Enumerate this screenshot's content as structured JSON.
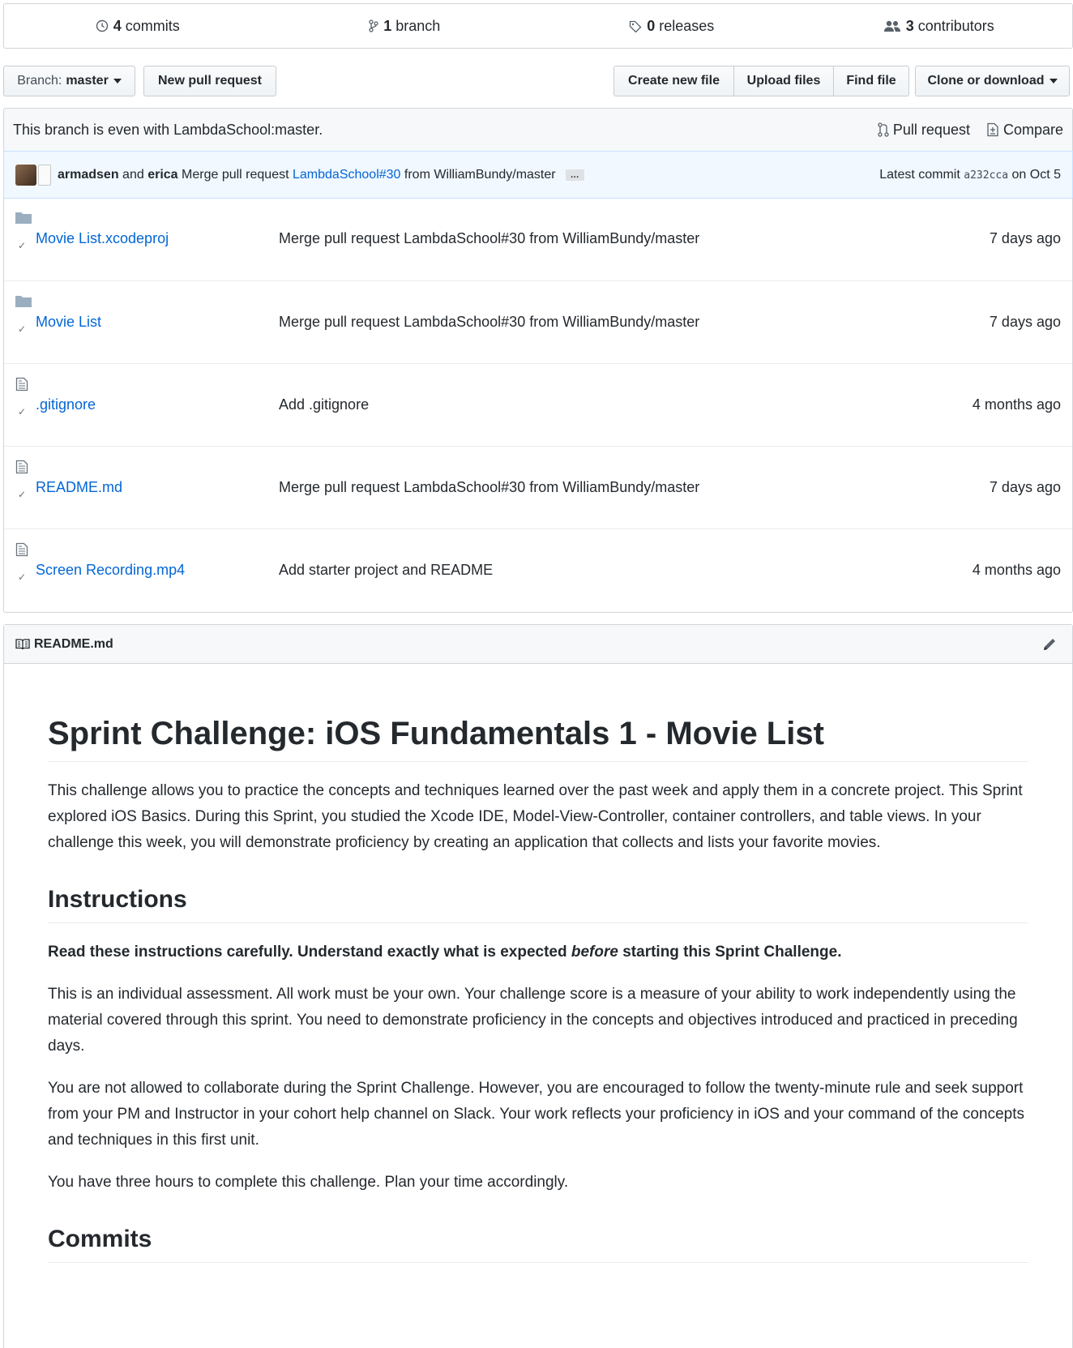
{
  "summary": {
    "commits": {
      "count": "4",
      "label": "commits"
    },
    "branches": {
      "count": "1",
      "label": "branch"
    },
    "releases": {
      "count": "0",
      "label": "releases"
    },
    "contributors": {
      "count": "3",
      "label": "contributors"
    }
  },
  "toolbar": {
    "branch_prefix": "Branch:",
    "branch_name": "master",
    "new_pr": "New pull request",
    "create_file": "Create new file",
    "upload_files": "Upload files",
    "find_file": "Find file",
    "clone": "Clone or download"
  },
  "branch_info": {
    "status": "This branch is even with LambdaSchool:master.",
    "pull_request": "Pull request",
    "compare": "Compare"
  },
  "latest_commit": {
    "author1": "armadsen",
    "and": "and",
    "author2": "erica",
    "message_prefix": "Merge pull request",
    "pr_link": "LambdaSchool#30",
    "message_suffix": "from WilliamBundy/master",
    "ellipsis": "…",
    "latest_label": "Latest commit",
    "sha": "a232cca",
    "date": "on Oct 5"
  },
  "files": [
    {
      "type": "dir",
      "name": "Movie List.xcodeproj",
      "message": "Merge pull request LambdaSchool#30 from WilliamBundy/master",
      "age": "7 days ago"
    },
    {
      "type": "dir",
      "name": "Movie List",
      "message": "Merge pull request LambdaSchool#30 from WilliamBundy/master",
      "age": "7 days ago"
    },
    {
      "type": "file",
      "name": ".gitignore",
      "message": "Add .gitignore",
      "age": "4 months ago"
    },
    {
      "type": "file",
      "name": "README.md",
      "message": "Merge pull request LambdaSchool#30 from WilliamBundy/master",
      "age": "7 days ago"
    },
    {
      "type": "file",
      "name": "Screen Recording.mp4",
      "message": "Add starter project and README",
      "age": "4 months ago"
    }
  ],
  "readme": {
    "filename": "README.md",
    "title": "Sprint Challenge: iOS Fundamentals 1 - Movie List",
    "intro": "This challenge allows you to practice the concepts and techniques learned over the past week and apply them in a concrete project. This Sprint explored iOS Basics. During this Sprint, you studied the Xcode IDE, Model-View-Controller, container controllers, and table views. In your challenge this week, you will demonstrate proficiency by creating an application that collects and lists your favorite movies.",
    "instructions_heading": "Instructions",
    "bold_pre": "Read these instructions carefully. Understand exactly what is expected ",
    "bold_em": "before",
    "bold_post": " starting this Sprint Challenge.",
    "p1": "This is an individual assessment. All work must be your own. Your challenge score is a measure of your ability to work independently using the material covered through this sprint. You need to demonstrate proficiency in the concepts and objectives introduced and practiced in preceding days.",
    "p2": "You are not allowed to collaborate during the Sprint Challenge. However, you are encouraged to follow the twenty-minute rule and seek support from your PM and Instructor in your cohort help channel on Slack. Your work reflects your proficiency in iOS and your command of the concepts and techniques in this first unit.",
    "p3": "You have three hours to complete this challenge. Plan your time accordingly.",
    "commits_heading": "Commits"
  }
}
